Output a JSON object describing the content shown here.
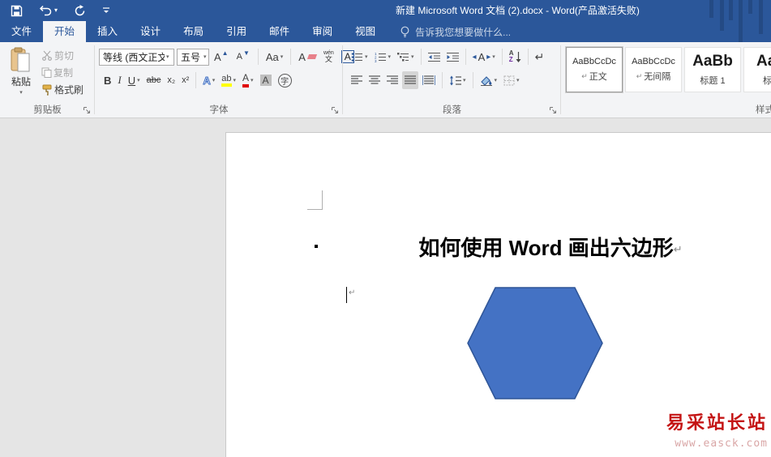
{
  "titlebar": {
    "title": "新建 Microsoft Word 文档 (2).docx - Word(产品激活失败)"
  },
  "tabs": [
    {
      "label": "文件"
    },
    {
      "label": "开始"
    },
    {
      "label": "插入"
    },
    {
      "label": "设计"
    },
    {
      "label": "布局"
    },
    {
      "label": "引用"
    },
    {
      "label": "邮件"
    },
    {
      "label": "审阅"
    },
    {
      "label": "视图"
    }
  ],
  "tellme": {
    "text": "告诉我您想要做什么..."
  },
  "ribbon": {
    "clipboard": {
      "label": "剪贴板",
      "paste": "粘贴",
      "cut": "剪切",
      "copy": "复制",
      "format_painter": "格式刷"
    },
    "font": {
      "label": "字体",
      "name_value": "等线 (西文正文",
      "size_value": "五号",
      "bold": "B",
      "italic": "I",
      "underline": "U",
      "strikethrough": "abc",
      "subscript": "x₂",
      "superscript": "x²",
      "grow": "A",
      "shrink": "A",
      "case": "Aa",
      "phonetic_top": "wén",
      "phonetic_bottom": "文",
      "char_border": "A",
      "effects": "A",
      "highlight": "ab",
      "font_color": "A",
      "char_shade": "A",
      "enclose": "字",
      "clear": "A"
    },
    "paragraph": {
      "label": "段落",
      "sort_a": "A",
      "sort_z": "Z",
      "scale": "A",
      "show_mark": "↵"
    },
    "styles": {
      "label": "样式",
      "items": [
        {
          "preview": "AaBbCcDc",
          "mark": "↵",
          "name": "正文"
        },
        {
          "preview": "AaBbCcDc",
          "mark": "↵",
          "name": "无间隔"
        },
        {
          "preview": "AaBb",
          "mark": "",
          "name": "标题 1"
        },
        {
          "preview": "AaB",
          "mark": "",
          "name": "标题"
        }
      ]
    }
  },
  "document": {
    "title": "如何使用 Word 画出六边形",
    "pilcrow": "↵",
    "hexagon": {
      "fill": "#4472C4",
      "stroke": "#2F5597"
    },
    "watermark": {
      "line1": "易采站长站",
      "line2": "www.easck.com",
      "color_line1": "#C41414",
      "color_line2": "#D9A6A6"
    }
  },
  "colors": {
    "titlebar": "#2B579A",
    "ribbon_bg": "#F3F4F6",
    "doc_bg": "#E5E5E5",
    "accent": "#2B579A"
  }
}
